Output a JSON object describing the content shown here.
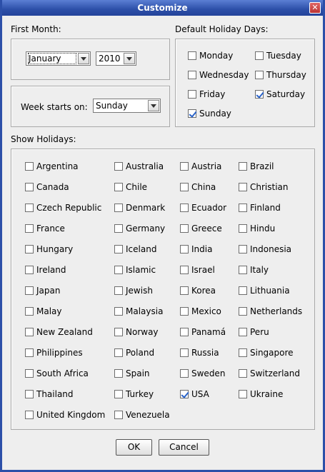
{
  "window": {
    "title": "Customize",
    "close_glyph": "✕"
  },
  "first_month": {
    "label": "First Month:",
    "month": "January",
    "year": "2010"
  },
  "week_start": {
    "label": "Week starts on:",
    "value": "Sunday"
  },
  "default_holiday_days": {
    "label": "Default Holiday Days:",
    "days": [
      {
        "label": "Monday",
        "checked": false
      },
      {
        "label": "Tuesday",
        "checked": false
      },
      {
        "label": "Wednesday",
        "checked": false
      },
      {
        "label": "Thursday",
        "checked": false
      },
      {
        "label": "Friday",
        "checked": false
      },
      {
        "label": "Saturday",
        "checked": true
      },
      {
        "label": "Sunday",
        "checked": true
      }
    ]
  },
  "show_holidays": {
    "label": "Show Holidays:",
    "countries": [
      {
        "label": "Argentina",
        "checked": false
      },
      {
        "label": "Australia",
        "checked": false
      },
      {
        "label": "Austria",
        "checked": false
      },
      {
        "label": "Brazil",
        "checked": false
      },
      {
        "label": "Canada",
        "checked": false
      },
      {
        "label": "Chile",
        "checked": false
      },
      {
        "label": "China",
        "checked": false
      },
      {
        "label": "Christian",
        "checked": false
      },
      {
        "label": "Czech Republic",
        "checked": false
      },
      {
        "label": "Denmark",
        "checked": false
      },
      {
        "label": "Ecuador",
        "checked": false
      },
      {
        "label": "Finland",
        "checked": false
      },
      {
        "label": "France",
        "checked": false
      },
      {
        "label": "Germany",
        "checked": false
      },
      {
        "label": "Greece",
        "checked": false
      },
      {
        "label": "Hindu",
        "checked": false
      },
      {
        "label": "Hungary",
        "checked": false
      },
      {
        "label": "Iceland",
        "checked": false
      },
      {
        "label": "India",
        "checked": false
      },
      {
        "label": "Indonesia",
        "checked": false
      },
      {
        "label": "Ireland",
        "checked": false
      },
      {
        "label": "Islamic",
        "checked": false
      },
      {
        "label": "Israel",
        "checked": false
      },
      {
        "label": "Italy",
        "checked": false
      },
      {
        "label": "Japan",
        "checked": false
      },
      {
        "label": "Jewish",
        "checked": false
      },
      {
        "label": "Korea",
        "checked": false
      },
      {
        "label": "Lithuania",
        "checked": false
      },
      {
        "label": "Malay",
        "checked": false
      },
      {
        "label": "Malaysia",
        "checked": false
      },
      {
        "label": "Mexico",
        "checked": false
      },
      {
        "label": "Netherlands",
        "checked": false
      },
      {
        "label": "New Zealand",
        "checked": false
      },
      {
        "label": "Norway",
        "checked": false
      },
      {
        "label": "Panamá",
        "checked": false
      },
      {
        "label": "Peru",
        "checked": false
      },
      {
        "label": "Philippines",
        "checked": false
      },
      {
        "label": "Poland",
        "checked": false
      },
      {
        "label": "Russia",
        "checked": false
      },
      {
        "label": "Singapore",
        "checked": false
      },
      {
        "label": "South Africa",
        "checked": false
      },
      {
        "label": "Spain",
        "checked": false
      },
      {
        "label": "Sweden",
        "checked": false
      },
      {
        "label": "Switzerland",
        "checked": false
      },
      {
        "label": "Thailand",
        "checked": false
      },
      {
        "label": "Turkey",
        "checked": false
      },
      {
        "label": "USA",
        "checked": true
      },
      {
        "label": "Ukraine",
        "checked": false
      },
      {
        "label": "United Kingdom",
        "checked": false
      },
      {
        "label": "Venezuela",
        "checked": false
      }
    ]
  },
  "buttons": {
    "ok": "OK",
    "cancel": "Cancel"
  },
  "colors": {
    "titlebar": "#2c4fa8",
    "background": "#eeeeee",
    "check": "#2a63c9"
  }
}
